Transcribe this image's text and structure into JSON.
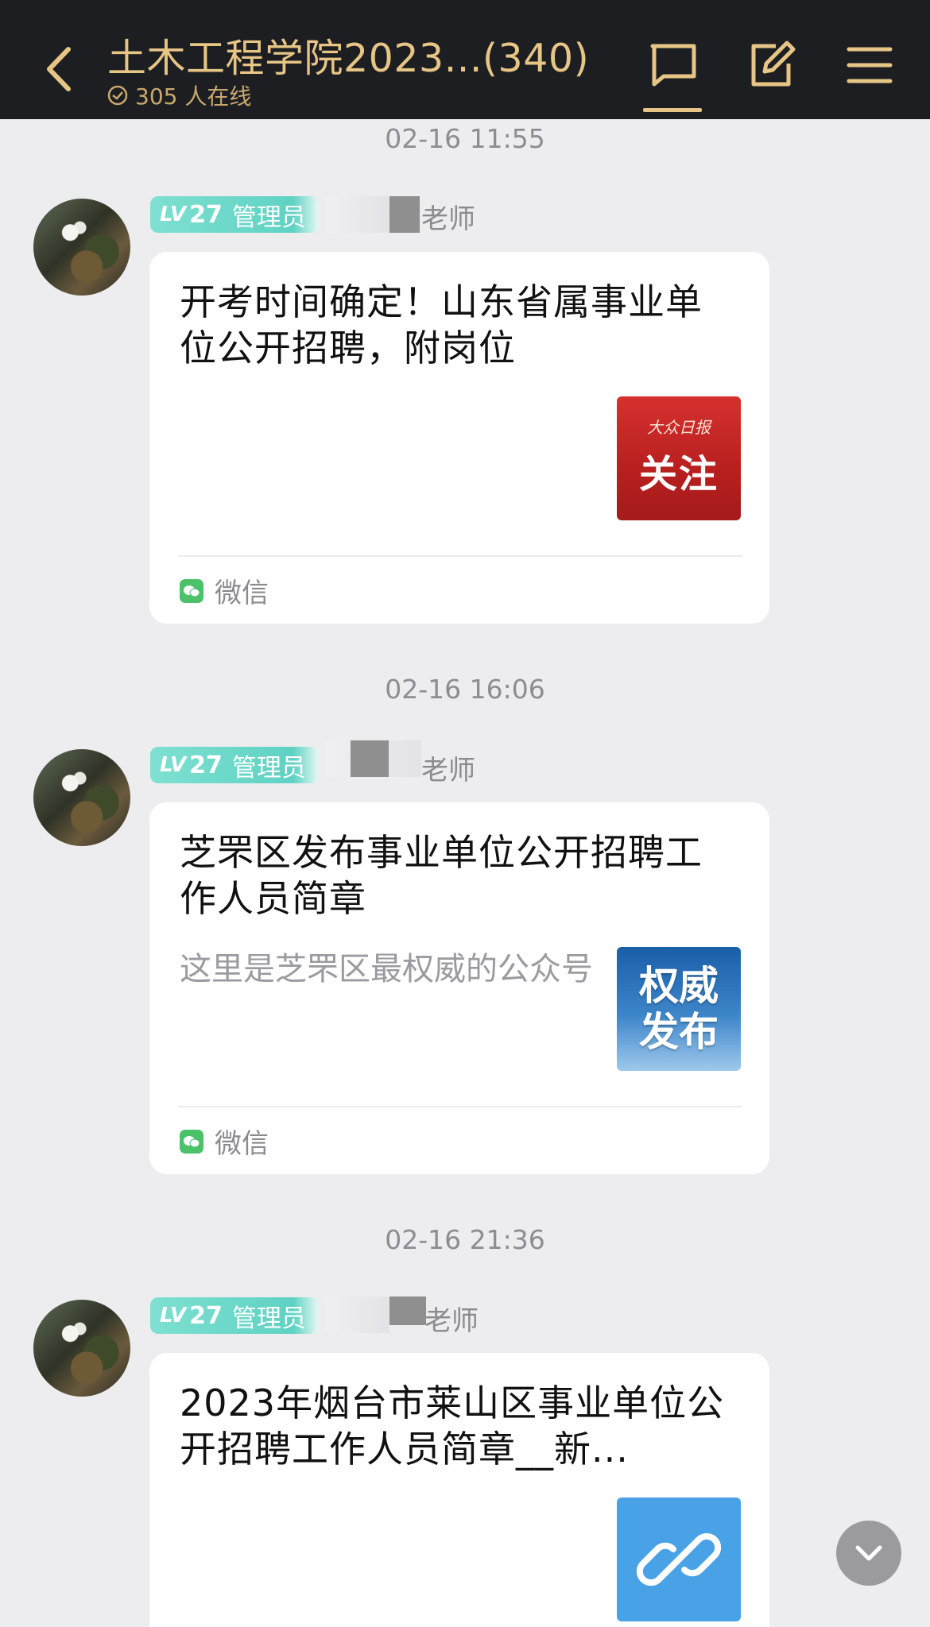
{
  "header": {
    "title": "土木工程学院2023...(340)",
    "online_status": "305 人在线",
    "accent_color": "#e6c585",
    "icons": [
      "back-arrow-icon",
      "chat-icon",
      "edit-icon",
      "menu-icon"
    ]
  },
  "messages": [
    {
      "timestamp": "02-16 11:55",
      "badge": {
        "lv_prefix": "LV",
        "lv": "27",
        "role": "管理员"
      },
      "sender_suffix": "老师",
      "card": {
        "title": "开考时间确定！山东省属事业单位公开招聘，附岗位",
        "description": "",
        "thumbnail": {
          "type": "red",
          "brand": "大众日报",
          "text": "关注"
        },
        "source": "微信"
      }
    },
    {
      "timestamp": "02-16 16:06",
      "badge": {
        "lv_prefix": "LV",
        "lv": "27",
        "role": "管理员"
      },
      "sender_suffix": "老师",
      "card": {
        "title": "芝罘区发布事业单位公开招聘工作人员简章",
        "description": "这里是芝罘区最权威的公众号",
        "thumbnail": {
          "type": "blue",
          "text": "权威发布"
        },
        "source": "微信"
      }
    },
    {
      "timestamp": "02-16 21:36",
      "badge": {
        "lv_prefix": "LV",
        "lv": "27",
        "role": "管理员"
      },
      "sender_suffix": "老师",
      "card": {
        "title": "2023年烟台市莱山区事业单位公开招聘工作人员简章__新...",
        "description": "",
        "thumbnail": {
          "type": "link",
          "icon": "link-icon"
        }
      }
    }
  ]
}
